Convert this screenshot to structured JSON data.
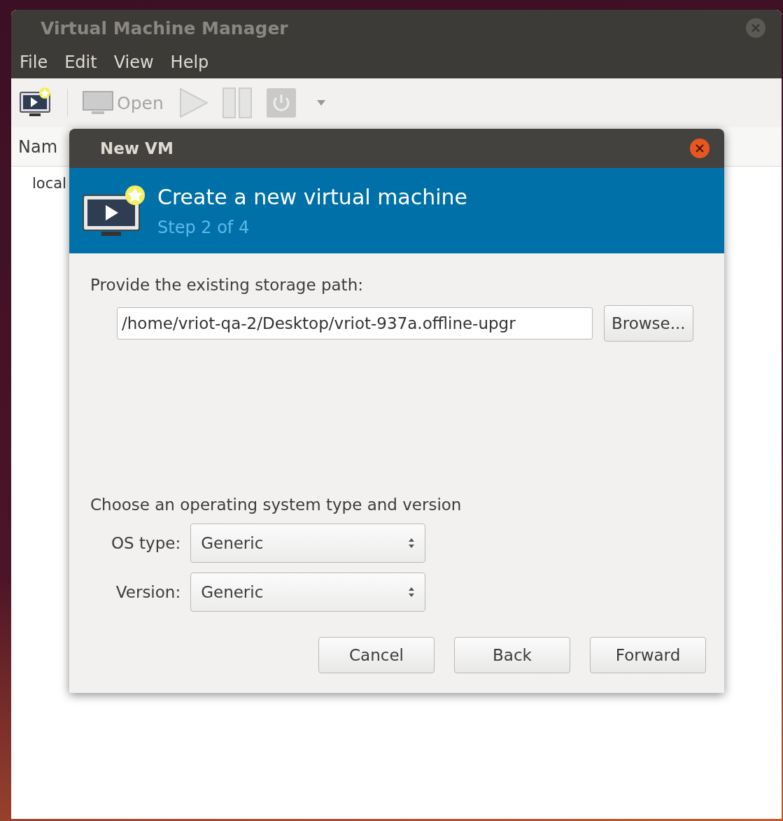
{
  "window": {
    "title": "Virtual Machine Manager"
  },
  "menu": [
    "File",
    "Edit",
    "View",
    "Help"
  ],
  "toolbar": [
    {
      "kind": "new"
    },
    {
      "kind": "separator"
    },
    {
      "kind": "open",
      "label": "Open",
      "disabled": true
    },
    {
      "kind": "run",
      "disabled": true
    },
    {
      "kind": "pause",
      "disabled": true
    },
    {
      "kind": "power",
      "disabled": true
    },
    {
      "kind": "dropdown"
    }
  ],
  "list": {
    "column": "Nam",
    "rows": [
      "local"
    ]
  },
  "dialog": {
    "title": "New VM",
    "header": {
      "title": "Create a new virtual machine",
      "step": "Step 2 of 4"
    },
    "storage_label": "Provide the existing storage path:",
    "storage_path": "/home/vriot-qa-2/Desktop/vriot-937a.offline-upgr",
    "browse": "Browse...",
    "os_heading": "Choose an operating system type and version",
    "selects": [
      {
        "label": "OS type:",
        "value": "Generic"
      },
      {
        "label": "Version:",
        "value": "Generic"
      }
    ],
    "buttons": [
      "Cancel",
      "Back",
      "Forward"
    ]
  }
}
